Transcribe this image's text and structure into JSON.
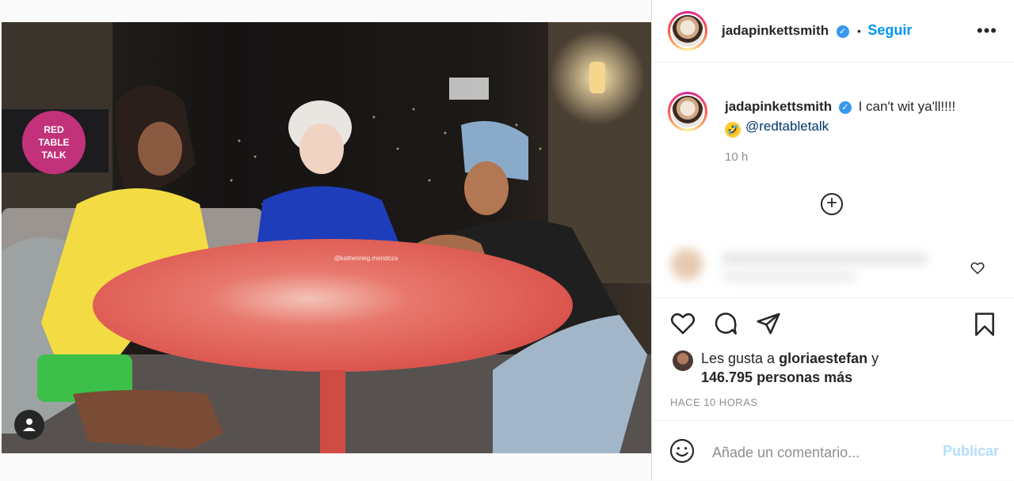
{
  "post": {
    "username": "jadapinkettsmith",
    "verified_mark": "✓",
    "follow_separator": "•",
    "follow_label": "Seguir",
    "more_label": "•••",
    "caption_text": "I can't wit ya'll!!!!",
    "caption_emoji": "🤣",
    "caption_mention": "@redtabletalk",
    "caption_time": "10 h",
    "load_more_icon": "+",
    "likes_prefix": "Les gusta a",
    "likes_user": "gloriaestefan",
    "likes_joiner": "y",
    "likes_count": "146.795 personas más",
    "time_ago": "HACE 10 HORAS",
    "comment_placeholder": "Añade un comentario...",
    "publish_label": "Publicar"
  },
  "media": {
    "show_text": "RED TABLE TALK",
    "show_lines": [
      "RED",
      "TABLE",
      "TALK"
    ],
    "watermark": "@katherineg.mendoza"
  },
  "colors": {
    "link_blue": "#0095f6",
    "publish_disabled": "#b2dffc",
    "table_red": "#e0554f"
  },
  "icons": [
    "heart-icon",
    "comment-icon",
    "share-icon",
    "bookmark-icon",
    "smiley-icon",
    "user-tag-icon",
    "plus-circle-icon",
    "verified-icon"
  ]
}
